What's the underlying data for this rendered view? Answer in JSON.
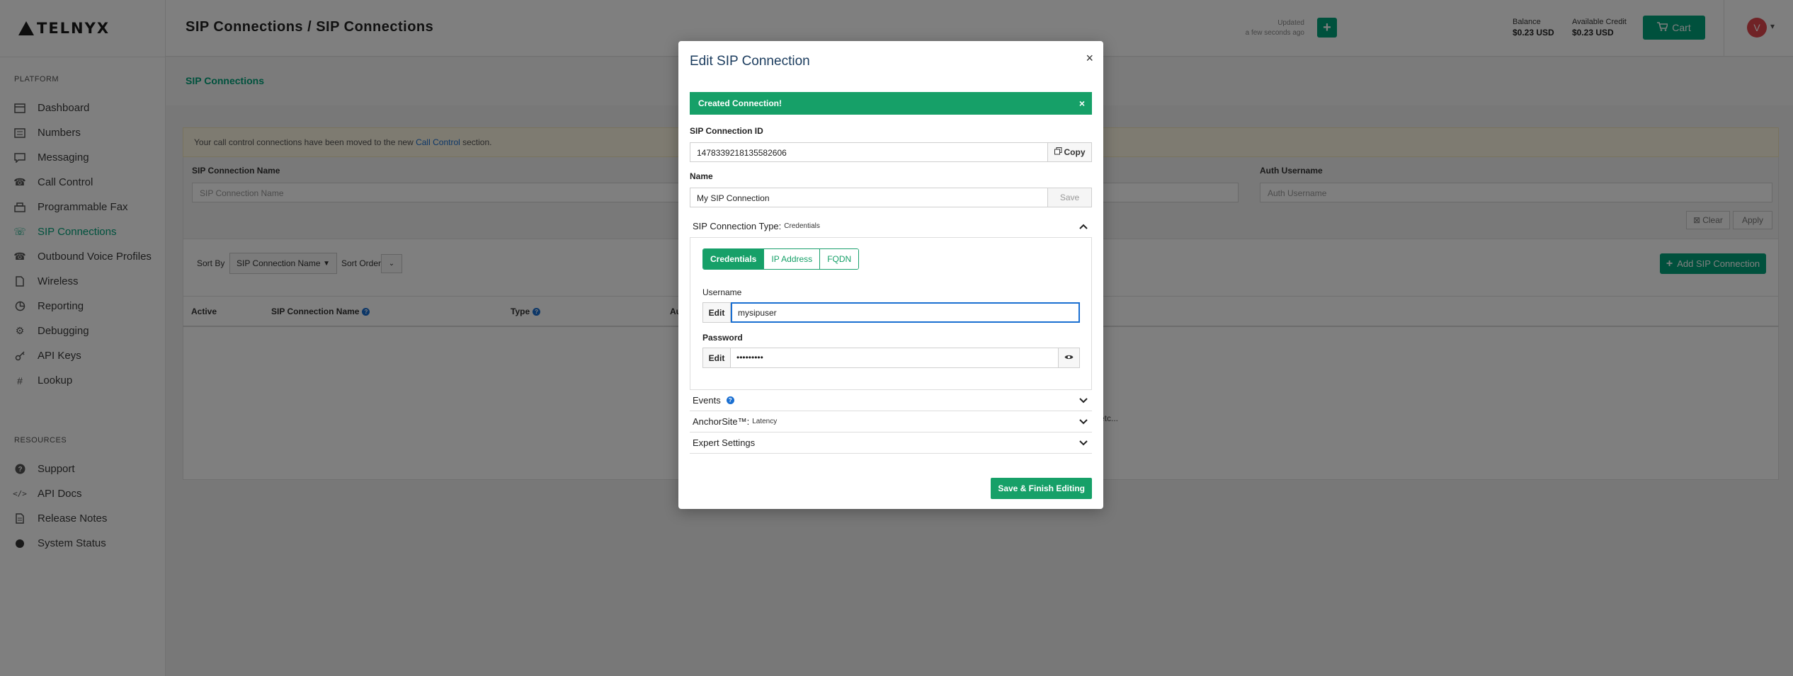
{
  "app": {
    "logo_text": "TELNYX",
    "page_title": "SIP Connections / SIP Connections"
  },
  "sidebar": {
    "platform_label": "PLATFORM",
    "platform_items": [
      {
        "label": "Dashboard",
        "icon": "dashboard-icon"
      },
      {
        "label": "Numbers",
        "icon": "numbers-icon"
      },
      {
        "label": "Messaging",
        "icon": "messaging-icon"
      },
      {
        "label": "Call Control",
        "icon": "phone-icon"
      },
      {
        "label": "Programmable Fax",
        "icon": "fax-icon"
      },
      {
        "label": "SIP Connections",
        "icon": "sip-icon",
        "active": true
      },
      {
        "label": "Outbound Voice Profiles",
        "icon": "outbound-phone-icon"
      },
      {
        "label": "Wireless",
        "icon": "sim-card-icon"
      },
      {
        "label": "Reporting",
        "icon": "reporting-icon"
      },
      {
        "label": "Debugging",
        "icon": "gear-icon"
      },
      {
        "label": "API Keys",
        "icon": "key-icon"
      },
      {
        "label": "Lookup",
        "icon": "hashtag-icon"
      }
    ],
    "resources_label": "RESOURCES",
    "resource_items": [
      {
        "label": "Support",
        "icon": "help-icon"
      },
      {
        "label": "API Docs",
        "icon": "code-icon"
      },
      {
        "label": "Release Notes",
        "icon": "document-icon"
      },
      {
        "label": "System Status",
        "icon": "status-dot-icon"
      }
    ]
  },
  "header": {
    "updated_label": "Updated",
    "updated_time": "a few seconds ago",
    "balance_label": "Balance",
    "balance_value": "$0.23 USD",
    "credit_label": "Available Credit",
    "credit_value": "$0.23 USD",
    "cart_label": "Cart",
    "avatar_letter": "V"
  },
  "content": {
    "breadcrumb": "SIP Connections",
    "notice_prefix": "Your call control connections have been moved to the new ",
    "notice_link": "Call Control",
    "notice_suffix": " section.",
    "filters": {
      "name_label": "SIP Connection Name",
      "name_placeholder": "SIP Connection Name",
      "auth_label": "Auth Username",
      "auth_placeholder": "Auth Username",
      "clear_label": "Clear",
      "apply_label": "Apply"
    },
    "sort_by_label": "Sort By",
    "sort_by_value": "SIP Connection Name",
    "sort_order_label": "Sort Order",
    "add_button_label": "Add SIP Connection",
    "table_headers": [
      "Active",
      "SIP Connection Name",
      "Type",
      "Au"
    ],
    "etc_text": "etc..."
  },
  "modal": {
    "title": "Edit SIP Connection",
    "alert_text": "Created Connection!",
    "id_label": "SIP Connection ID",
    "id_value": "1478339218135582606",
    "copy_label": "Copy",
    "name_label": "Name",
    "name_value": "My SIP Connection",
    "save_label": "Save",
    "type_label": "SIP Connection Type:",
    "type_value": "Credentials",
    "type_options": [
      "Credentials",
      "IP Address",
      "FQDN"
    ],
    "username_label": "Username",
    "edit_label": "Edit",
    "username_value": "mysipuser",
    "password_label": "Password",
    "password_value": "•••••••••",
    "events_label": "Events",
    "anchorsite_label": "AnchorSite™:",
    "anchorsite_value": "Latency",
    "expert_label": "Expert Settings",
    "finish_label": "Save & Finish Editing"
  },
  "colors": {
    "brand_green": "#00a37a",
    "alert_green": "#16a068",
    "link_blue": "#1a6fd1",
    "avatar_red": "#e0474c"
  }
}
